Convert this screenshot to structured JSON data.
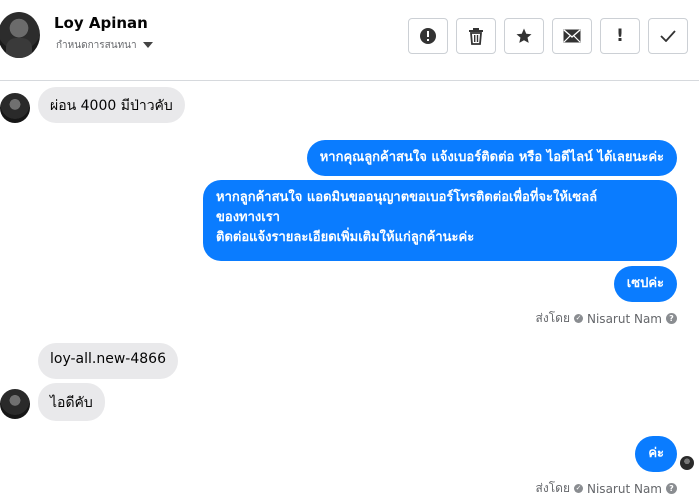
{
  "header": {
    "contact_name": "Loy Apinan",
    "subtitle": "กำหนดการสนทนา",
    "actions": [
      {
        "name": "alert-circle-icon",
        "glyph": "!"
      },
      {
        "name": "trash-icon",
        "glyph": ""
      },
      {
        "name": "star-icon",
        "glyph": "★"
      },
      {
        "name": "mail-icon",
        "glyph": "✉"
      },
      {
        "name": "exclamation-icon",
        "glyph": "!"
      },
      {
        "name": "check-icon",
        "glyph": "✓"
      }
    ]
  },
  "messages": {
    "m1": "ผ่อน 4000 มีป่าวคับ",
    "m2": "หากคุณลูกค้าสนใจ แจ้งเบอร์ติดต่อ หรือ ไอดีไลน์ ได้เลยนะค่ะ",
    "m3_line1": "หากลูกค้าสนใจ แอดมินขออนุญาตขอเบอร์โทรติดต่อเพื่อที่จะให้เซลล์",
    "m3_line2": "ของทางเรา",
    "m3_line3": "ติดต่อแจ้งรายละเอียดเพิ่มเติมให้แก่ลูกค้านะค่ะ",
    "m4": "เซปค่ะ",
    "sent_by_1": "ส่งโดย",
    "agent_1": "Nisarut Nam",
    "m5": "loy-all.new-4866",
    "m6": "ไอดีคับ",
    "m7": "ค่ะ",
    "sent_by_2": "ส่งโดย",
    "agent_2": "Nisarut Nam"
  },
  "colors": {
    "outgoing_bubble": "#0a7cff",
    "incoming_bubble": "#e9e9eb",
    "muted_text": "#65676b"
  }
}
